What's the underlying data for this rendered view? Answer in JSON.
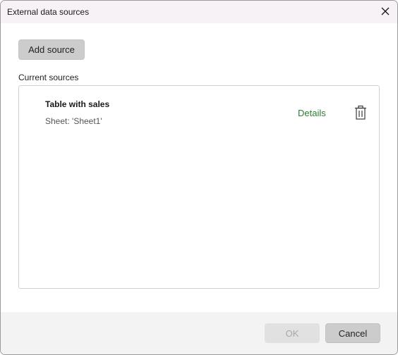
{
  "window": {
    "title": "External data sources",
    "close_icon": "close-icon"
  },
  "toolbar": {
    "add_label": "Add source"
  },
  "sources": {
    "section_label": "Current sources",
    "items": [
      {
        "name": "Table with sales",
        "sheet": "Sheet: 'Sheet1'",
        "details_label": "Details",
        "delete_icon": "trash-icon"
      }
    ]
  },
  "footer": {
    "ok_label": "OK",
    "cancel_label": "Cancel"
  },
  "colors": {
    "titlebar_bg": "#f7f2f6",
    "details_link": "#2e7d32",
    "button_bg": "#cccccc",
    "disabled_text": "#a8a8a8"
  }
}
